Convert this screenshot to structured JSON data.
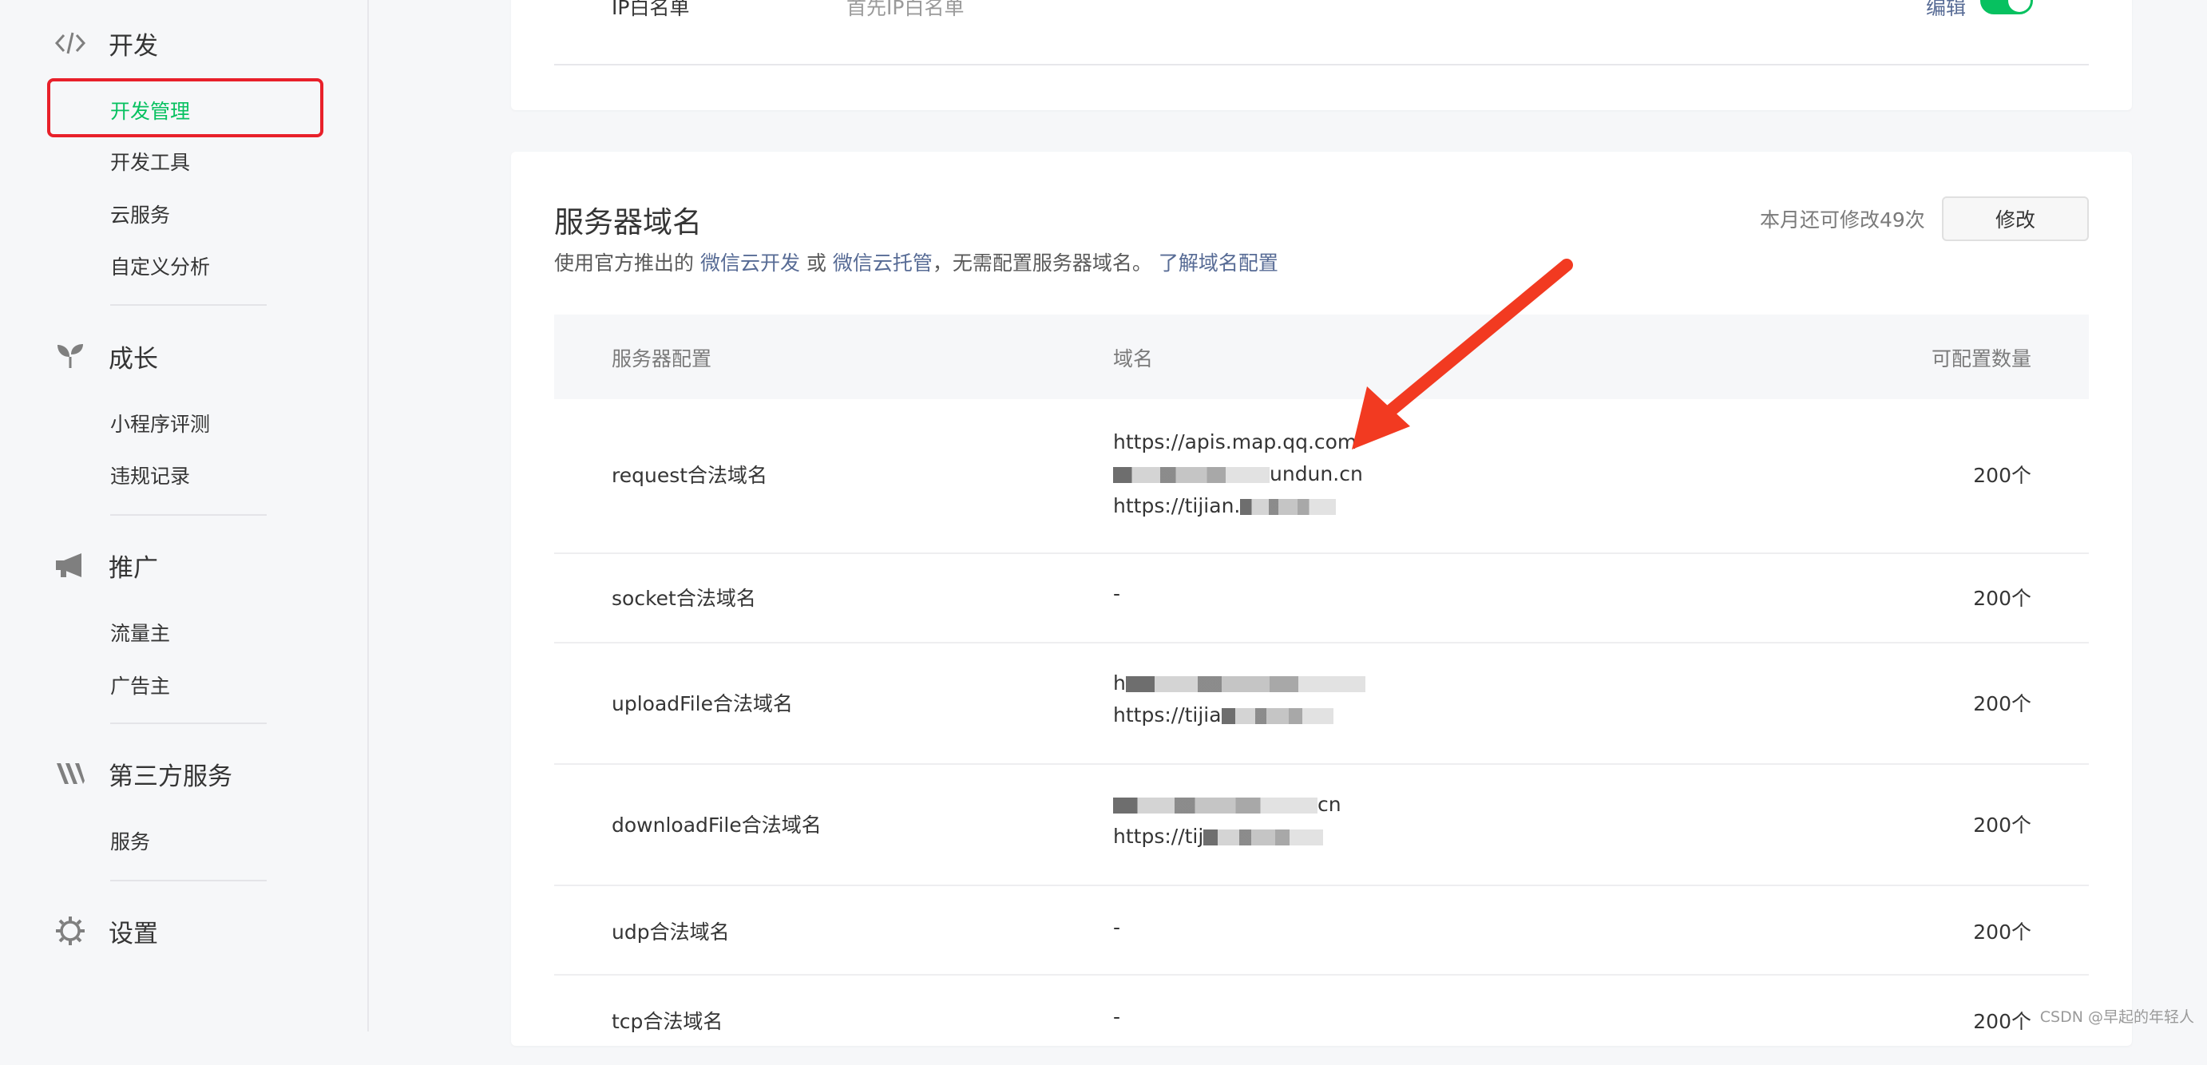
{
  "sidebar": {
    "groups": [
      {
        "label": "开发",
        "icon": "code-icon",
        "items": [
          "开发管理",
          "开发工具",
          "云服务",
          "自定义分析"
        ]
      },
      {
        "label": "成长",
        "icon": "sprout-icon",
        "items": [
          "小程序评测",
          "违规记录"
        ]
      },
      {
        "label": "推广",
        "icon": "megaphone-icon",
        "items": [
          "流量主",
          "广告主"
        ]
      },
      {
        "label": "第三方服务",
        "icon": "third-party-icon",
        "items": [
          "服务"
        ]
      },
      {
        "label": "设置",
        "icon": "gear-icon",
        "items": []
      }
    ],
    "active_item": "开发管理"
  },
  "top_card": {
    "label": "IP白名单",
    "desc": "首先IP白名单",
    "edit_link": "编辑",
    "toggle_on": true
  },
  "server_domain": {
    "title": "服务器域名",
    "desc_prefix": "使用官方推出的",
    "link_cloud_dev": "微信云开发",
    "or_text": "或",
    "link_cloud_host": "微信云托管",
    "desc_suffix": "，无需配置服务器域名。",
    "link_learn": "了解域名配置",
    "remaining": "本月还可修改49次",
    "modify_button": "修改",
    "table": {
      "headers": [
        "服务器配置",
        "域名",
        "可配置数量"
      ],
      "rows": [
        {
          "name": "request合法域名",
          "domains": [
            "https://apis.map.qq.com",
            "undun.cn",
            "https://tijian."
          ],
          "count": "200个"
        },
        {
          "name": "socket合法域名",
          "domains": [
            "-"
          ],
          "count": "200个"
        },
        {
          "name": "uploadFile合法域名",
          "domains": [
            "h",
            "https://tijia"
          ],
          "count": "200个"
        },
        {
          "name": "downloadFile合法域名",
          "domains": [
            "cn",
            "https://tij"
          ],
          "count": "200个"
        },
        {
          "name": "udp合法域名",
          "domains": [
            "-"
          ],
          "count": "200个"
        },
        {
          "name": "tcp合法域名",
          "domains": [
            "-"
          ],
          "count": "200个"
        }
      ]
    }
  },
  "watermark": "CSDN @早起的年轻人",
  "colors": {
    "accent": "#07c160",
    "link": "#576b95",
    "highlight": "#e8202a",
    "arrow": "#f23a21"
  }
}
